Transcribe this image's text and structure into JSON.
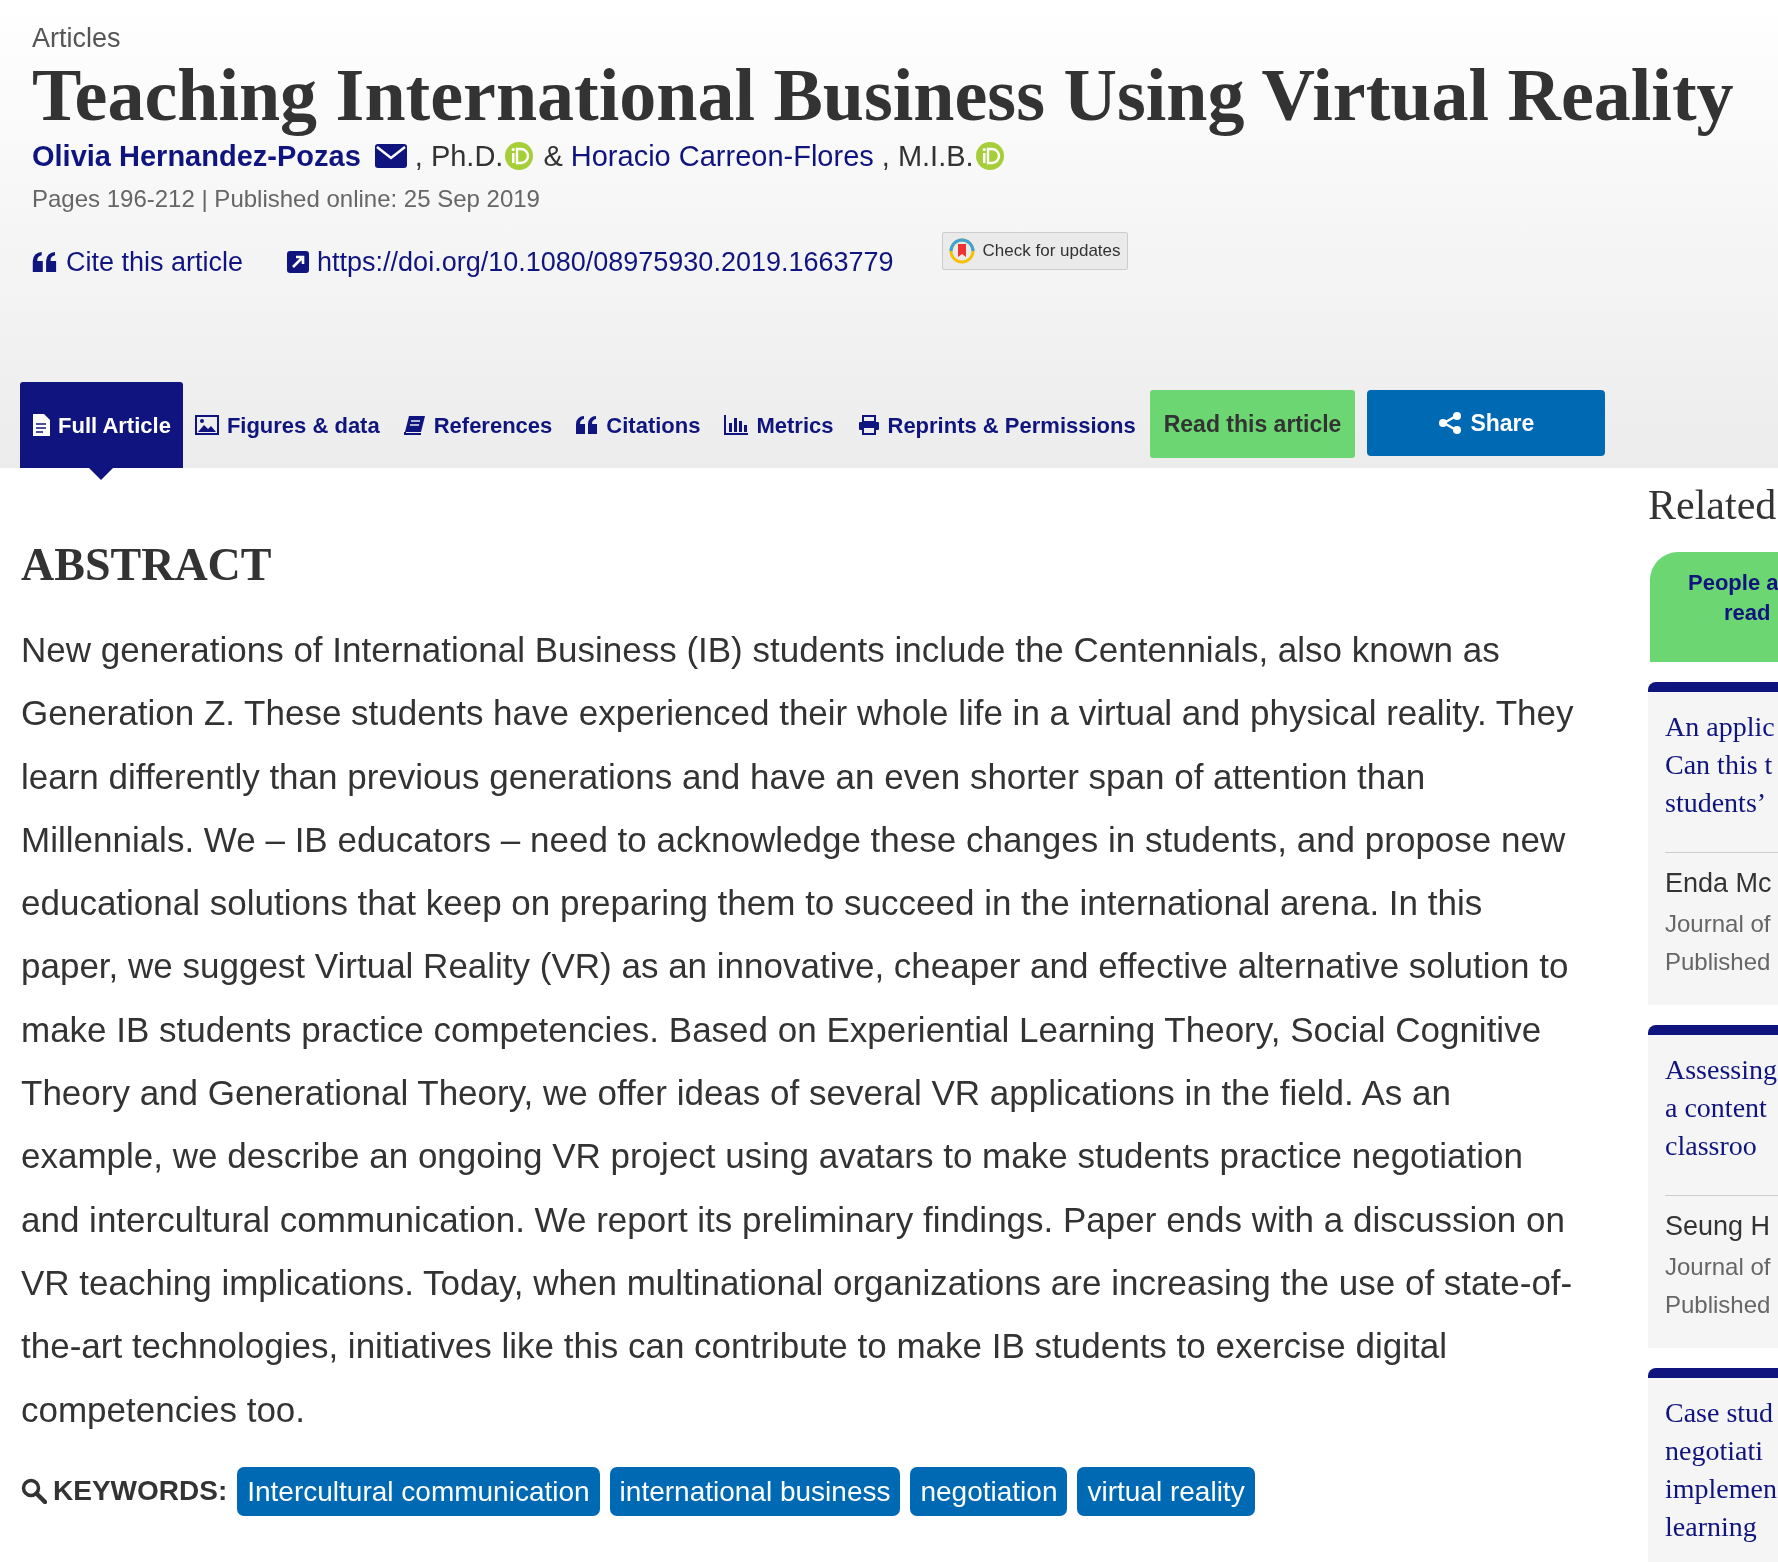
{
  "breadcrumb": "Articles",
  "title": "Teaching International Business Using Virtual Reality",
  "authors": [
    {
      "name": "Olivia Hernandez-Pozas",
      "email": true,
      "degree": ", Ph.D.",
      "orcid": true
    },
    {
      "name": "Horacio Carreon-Flores",
      "email": false,
      "degree": ", M.I.B.",
      "orcid": true
    }
  ],
  "author_separator": "&",
  "meta": "Pages 196-212 | Published online: 25 Sep 2019",
  "cite": "Cite this article",
  "doi": "https://doi.org/10.1080/08975930.2019.1663779",
  "updates_button": "Check for updates",
  "tabs": [
    {
      "label": "Full Article",
      "selected": true
    },
    {
      "label": "Figures & data",
      "selected": false
    },
    {
      "label": "References",
      "selected": false
    },
    {
      "label": "Citations",
      "selected": false
    },
    {
      "label": "Metrics",
      "selected": false
    },
    {
      "label": "Reprints & Permissions",
      "selected": false
    }
  ],
  "read_button": "Read this article",
  "share_button": "Share",
  "abstract": {
    "heading": "ABSTRACT",
    "text": "New generations of International Business (IB) students include the Centennials, also known as Generation Z. These students have experienced their whole life in a virtual and physical reality. They learn differently than previous generations and have an even shorter span of attention than Millennials. We – IB educators – need to acknowledge these changes in students, and propose new educational solutions that keep on preparing them to succeed in the international arena. In this paper, we suggest Virtual Reality (VR) as an innovative, cheaper and effective alternative solution to make IB students practice competencies. Based on Experiential Learning Theory, Social Cognitive Theory and Generational Theory, we offer ideas of several VR applications in the field. As an example, we describe an ongoing VR project using avatars to make students practice negotiation and intercultural communication. We report its preliminary findings. Paper ends with a discussion on VR teaching implications. Today, when multinational organizations are increasing the use of state-of-the-art technologies, initiatives like this can contribute to make IB students to exercise digital competencies too."
  },
  "keywords": {
    "label": "KEYWORDS:",
    "items": [
      "Intercultural communication",
      "international business",
      "negotiation",
      "virtual reality"
    ]
  },
  "related": {
    "heading": "Related",
    "tab": [
      "People a",
      "read"
    ],
    "cards": [
      {
        "title": [
          "An applic",
          "Can this t",
          "students’"
        ],
        "author": "Enda Mc",
        "journal": "Journal of",
        "published": "Published"
      },
      {
        "title": [
          "Assessing",
          "a content",
          "classroo"
        ],
        "author": "Seung H",
        "journal": "Journal of",
        "published": "Published"
      },
      {
        "title": [
          "Case stud",
          "negotiati",
          "implemen",
          "learning"
        ]
      }
    ]
  }
}
